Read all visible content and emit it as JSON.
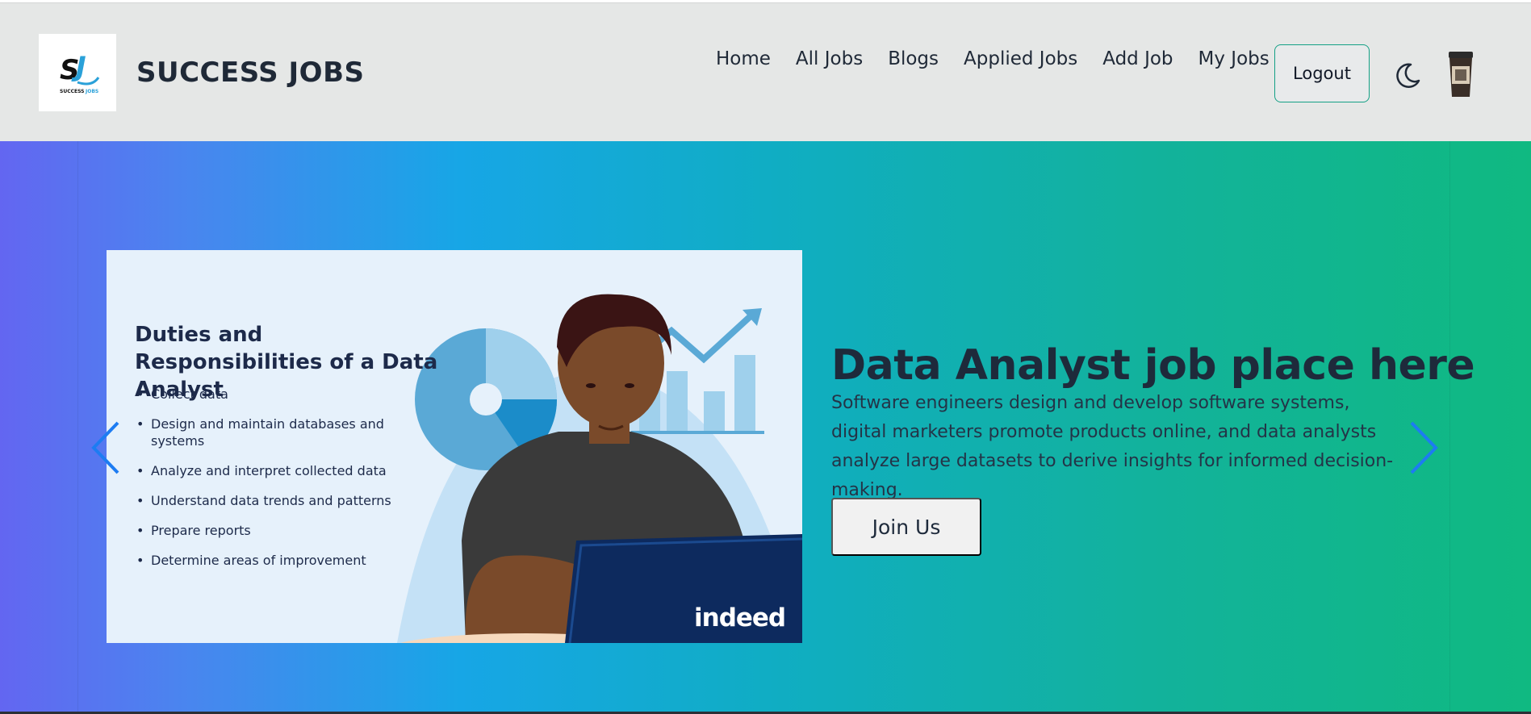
{
  "brand": {
    "name": "SUCCESS JOBS",
    "logo_text": "SJ",
    "logo_caption_left": "SUCCESS",
    "logo_caption_right": "JOBS"
  },
  "nav": {
    "items": [
      {
        "label": "Home"
      },
      {
        "label": "All Jobs"
      },
      {
        "label": "Blogs"
      },
      {
        "label": "Applied Jobs"
      },
      {
        "label": "Add Job"
      },
      {
        "label": "My Jobs"
      }
    ],
    "logout_label": "Logout",
    "theme_icon": "moon-icon",
    "avatar_icon": "avatar-cup-icon"
  },
  "hero": {
    "image": {
      "title": "Duties and Responsibilities of a Data Analyst",
      "items": [
        "Collect data",
        "Design and maintain databases and systems",
        "Analyze and interpret collected data",
        "Understand data trends and patterns",
        "Prepare reports",
        "Determine areas of improvement"
      ],
      "brand": "indeed"
    },
    "title": "Data Analyst job place here",
    "description": "Software engineers design and develop software systems, digital marketers promote products online, and data analysts analyze large datasets to derive insights for informed decision-making.",
    "cta_label": "Join Us",
    "prev_icon": "chevron-left-icon",
    "next_icon": "chevron-right-icon"
  },
  "colors": {
    "navbar_bg": "#e5e7e6",
    "gradient_start": "#6366f1",
    "gradient_mid": "#17a6e6",
    "gradient_end": "#10b981",
    "logout_border": "#14a085",
    "arrow": "#1d7cf2"
  }
}
